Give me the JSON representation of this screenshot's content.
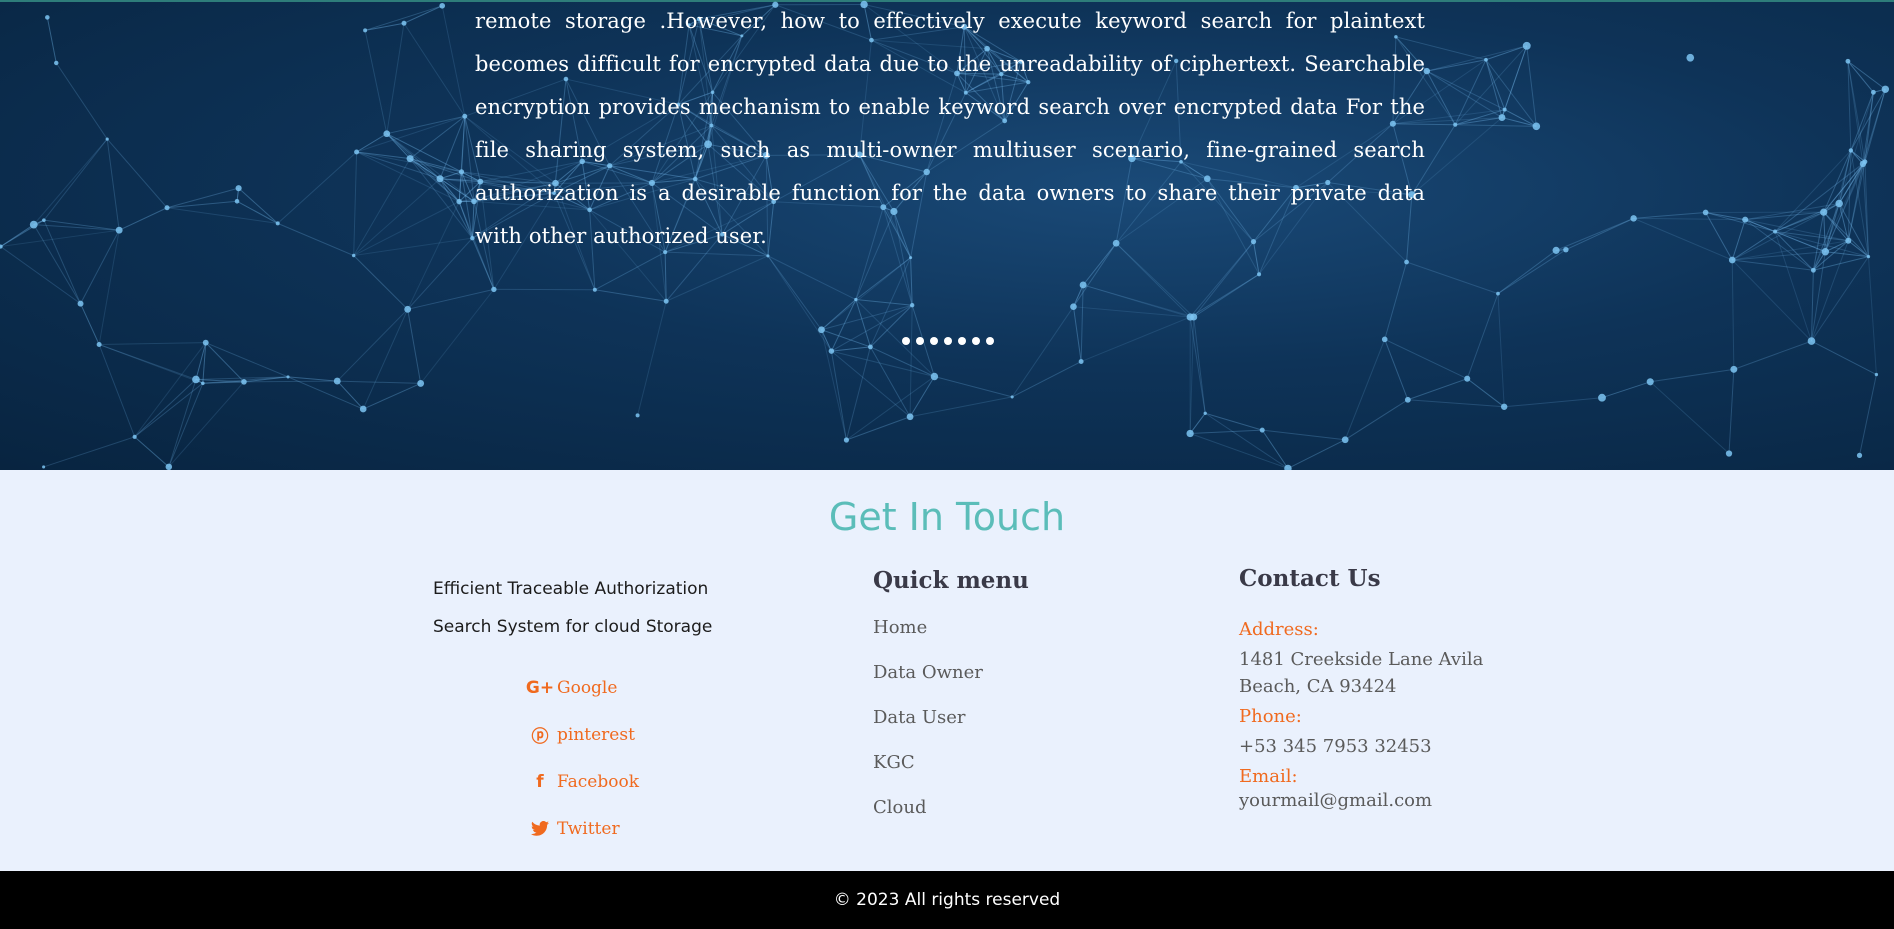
{
  "hero": {
    "paragraph": "remote storage .However, how to effectively execute keyword search for plaintext becomes difficult for encrypted data due to the unreadability of ciphertext. Searchable encryption provides mechanism to enable keyword search over encrypted data For the file sharing system, such as multi-owner multiuser scenario, fine-grained search authorization is a desirable function for the data owners to share their private data with other authorized user.",
    "slide_count": 7
  },
  "contact_section": {
    "title": "Get In Touch",
    "brand": {
      "line1": "Efficient Traceable Authorization",
      "line2": "Search System for cloud Storage"
    },
    "social": [
      {
        "icon": "google-plus-icon",
        "glyph": "G+",
        "label": "Google"
      },
      {
        "icon": "pinterest-icon",
        "glyph": "ⓟ",
        "label": "pinterest"
      },
      {
        "icon": "facebook-icon",
        "glyph": "f",
        "label": "Facebook"
      },
      {
        "icon": "twitter-icon",
        "glyph": "🐦",
        "label": "Twitter"
      }
    ],
    "quick_menu": {
      "heading": "Quick menu",
      "items": [
        "Home",
        "Data Owner",
        "Data User",
        "KGC",
        "Cloud"
      ]
    },
    "contact": {
      "heading": "Contact Us",
      "address_label": "Address:",
      "address_line1": "1481 Creekside Lane Avila",
      "address_line2": "Beach, CA 93424",
      "phone_label": "Phone:",
      "phone": "+53 345 7953 32453",
      "email_label": "Email:",
      "email": "yourmail@gmail.com"
    }
  },
  "footer": {
    "copyright": "© 2023 All rights reserved"
  },
  "colors": {
    "accent_orange": "#f06a1f",
    "title_teal": "#5bbdb9",
    "section_bg": "#eaf1fd",
    "hero_bg": "#0e3358",
    "footer_bg": "#000000"
  }
}
